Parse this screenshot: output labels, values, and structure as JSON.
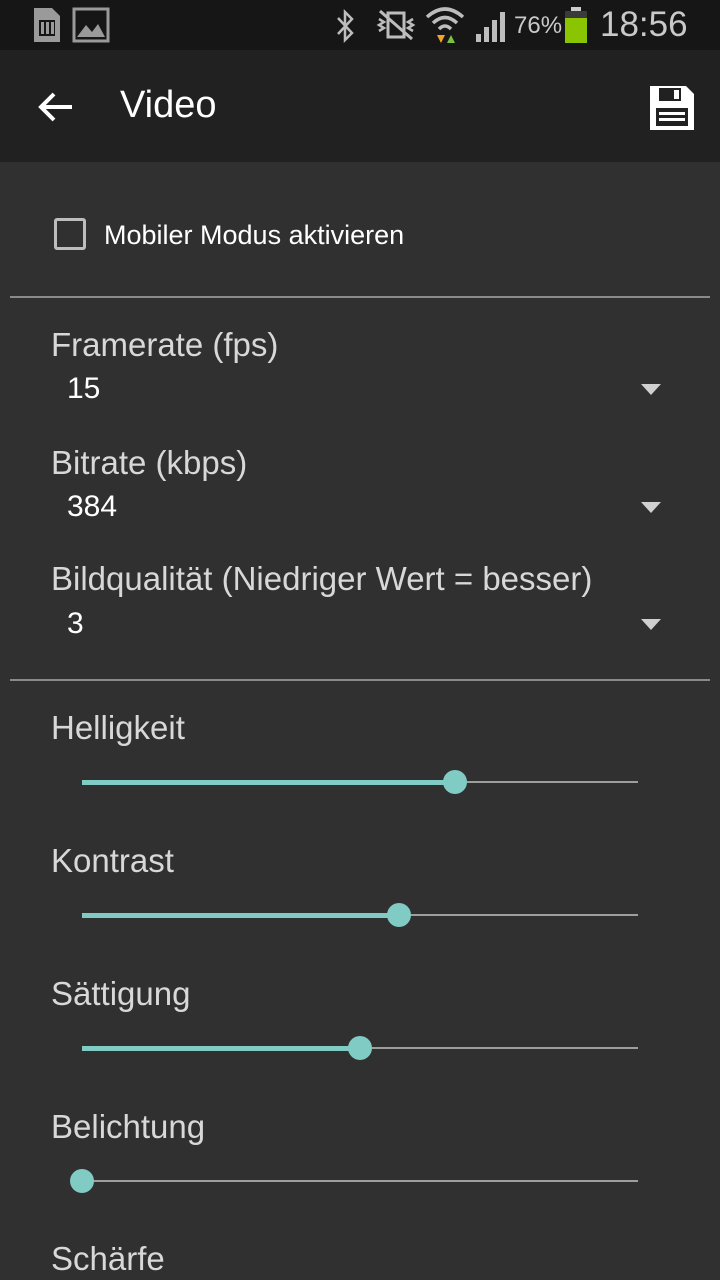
{
  "status_bar": {
    "battery_percent": "76%",
    "time": "18:56",
    "icons": [
      "sd-card-icon",
      "image-icon",
      "bluetooth-icon",
      "vibrate-icon",
      "wifi-icon",
      "signal-icon",
      "battery-icon"
    ],
    "battery_level": 0.76,
    "battery_color": "#8bc400"
  },
  "toolbar": {
    "title": "Video",
    "back_icon": "arrow-back-icon",
    "save_icon": "save-icon"
  },
  "mobile_mode": {
    "label": "Mobiler Modus aktivieren",
    "checked": false
  },
  "settings": {
    "framerate": {
      "label": "Framerate (fps)",
      "value": "15"
    },
    "bitrate": {
      "label": "Bitrate (kbps)",
      "value": "384"
    },
    "quality": {
      "label": "Bildqualität (Niedriger Wert = besser)",
      "value": "3"
    }
  },
  "sliders": [
    {
      "label": "Helligkeit",
      "value": 0.67
    },
    {
      "label": "Kontrast",
      "value": 0.57
    },
    {
      "label": "Sättigung",
      "value": 0.5
    },
    {
      "label": "Belichtung",
      "value": 0.0
    },
    {
      "label": "Schärfe"
    }
  ],
  "colors": {
    "accent": "#80cbc4",
    "background": "#303030",
    "toolbar": "#212121",
    "status_bar": "#161616"
  }
}
